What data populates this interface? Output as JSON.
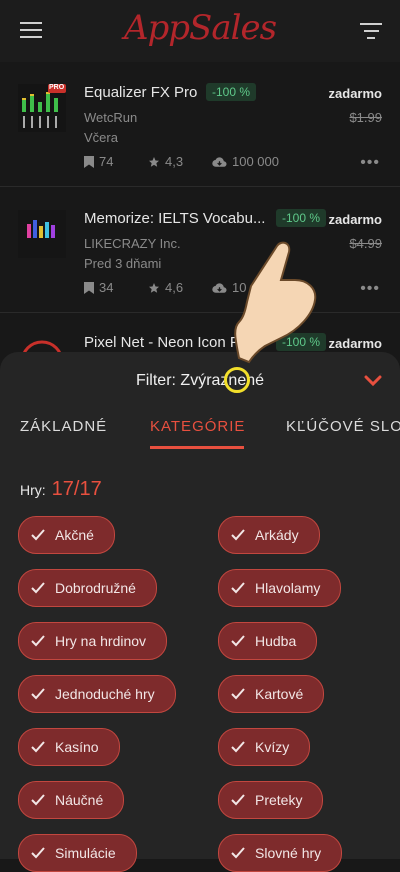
{
  "header": {
    "logo": "AppSales"
  },
  "apps": [
    {
      "title": "Equalizer FX Pro",
      "discount": "-100 %",
      "price": "zadarmo",
      "old_price": "$1.99",
      "developer": "WetcRun",
      "date": "Včera",
      "wishlist": "74",
      "rating": "4,3",
      "downloads": "100 000",
      "badge": "PRO"
    },
    {
      "title": "Memorize: IELTS Vocabu...",
      "discount": "-100 %",
      "price": "zadarmo",
      "old_price": "$4.99",
      "developer": "LIKECRAZY Inc.",
      "date": "Pred 3 dňami",
      "wishlist": "34",
      "rating": "4,6",
      "downloads": "10 00"
    },
    {
      "title": "Pixel Net - Neon Icon P",
      "discount": "-100 %",
      "price": "zadarmo"
    }
  ],
  "sheet": {
    "title": "Filter: Zvýraznené",
    "tabs": [
      "ZÁKLADNÉ",
      "KATEGÓRIE",
      "KĽÚČOVÉ SLO"
    ],
    "active_tab": "KATEGÓRIE",
    "count_label": "Hry:",
    "count_value": "17/17",
    "chips_left": [
      "Akčné",
      "Dobrodružné",
      "Hry na hrdinov",
      "Jednoduché hry",
      "Kasíno",
      "Náučné",
      "Simulácie"
    ],
    "chips_right": [
      "Arkády",
      "Hlavolamy",
      "Hudba",
      "Kartové",
      "Kvízy",
      "Preteky",
      "Slovné hry"
    ]
  },
  "colors": {
    "accent": "#e8503f",
    "chip_bg": "#7e2b2c",
    "discount": "#5fc98a"
  },
  "icons": [
    "menu-icon",
    "filter-icon",
    "bookmark-icon",
    "star-icon",
    "download-icon",
    "more-icon",
    "chevron-down-icon",
    "check-icon"
  ]
}
